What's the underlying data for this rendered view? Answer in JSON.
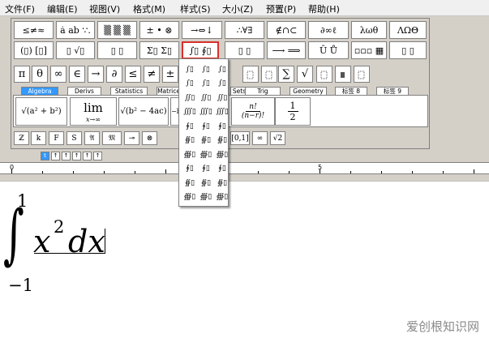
{
  "menu": [
    "文件(F)",
    "编辑(E)",
    "视图(V)",
    "格式(M)",
    "样式(S)",
    "大小(Z)",
    "预置(P)",
    "帮助(H)"
  ],
  "palette_row1": [
    "≤≠≈",
    "ȧ ab ∵.",
    "▒ ▒ ▒",
    "± • ⊗",
    "→⇔↓",
    "∴∀∃",
    "∉∩⊂",
    "∂∞ℓ",
    "λωθ",
    "ΛΩΘ"
  ],
  "palette_row2": [
    "(▯) [▯]",
    "▯ √▯",
    "▯ ▯",
    "Σ▯ Σ▯",
    "∫▯ ∮▯",
    "▯ ▯",
    "⟶ ⟹",
    "Ū Ů",
    "▫▫▫ ▦",
    "▯ ▯"
  ],
  "symbol_row": [
    "π",
    "θ",
    "∞",
    "∈",
    "→",
    "∂",
    "≤",
    "≠",
    "±",
    "",
    "",
    "",
    "",
    "∑",
    "√",
    "",
    "",
    ""
  ],
  "tabs": [
    "Algebra",
    "Derivs",
    "Statistics",
    "Matrices",
    "Sets",
    "Trig",
    "Geometry",
    "标签 8",
    "标签 9"
  ],
  "templates": {
    "pythag": "√(a² + b²)",
    "lim_main": "lim",
    "lim_sub": "x→∞",
    "discriminant": "√(b² − 4ac)",
    "discriminant_prefix": "−b",
    "factorial_num": "n!",
    "factorial_den": "(n−r)!",
    "half_num": "1",
    "half_den": "2"
  },
  "small_symbols": [
    "ℤ",
    "k",
    "F",
    "S",
    "𝔄",
    "𝔐",
    "⊸",
    "⊗",
    "[0,1]",
    "∞",
    "√2"
  ],
  "size_buttons": [
    "t",
    "↑",
    "↑",
    "↑",
    "↑",
    "↑"
  ],
  "ruler": {
    "start": "0",
    "mid": "5"
  },
  "dropdown_items": [
    "∫▯",
    "∫▯",
    "∫▯",
    "∫▯",
    "∫▯",
    "∫▯",
    "∬▯",
    "∬▯",
    "∬▯",
    "∭▯",
    "∭▯",
    "∭▯",
    "∮▯",
    "∮▯",
    "∮▯",
    "∯▯",
    "∯▯",
    "∯▯",
    "∰▯",
    "∰▯",
    "∰▯",
    "∮▯",
    "∮▯",
    "∮▯",
    "∯▯",
    "∯▯",
    "∯▯",
    "∰▯",
    "∰▯",
    "∰▯"
  ],
  "equation": {
    "upper": "1",
    "integral": "∫",
    "lower": "−1",
    "base": "x",
    "exponent": "2",
    "differential": "dx"
  },
  "watermark": "爱创根知识网",
  "colors": {
    "selected_border": "#d9302b",
    "active_tab": "#3399ff"
  }
}
